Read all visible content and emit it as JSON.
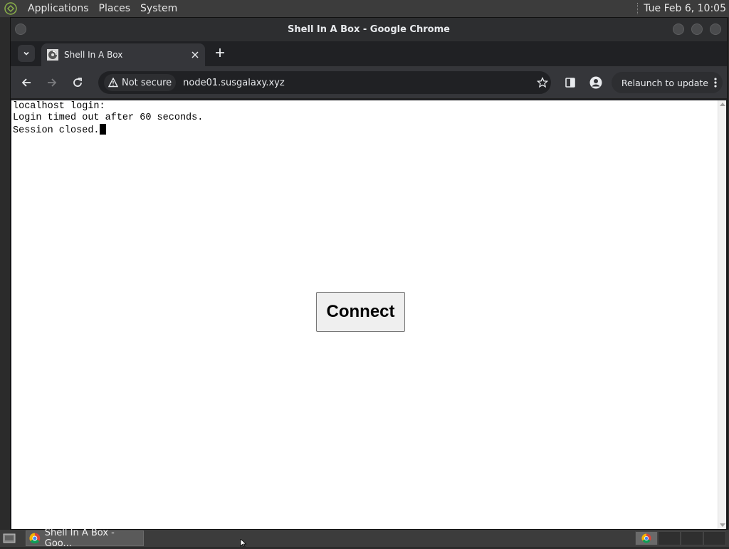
{
  "top_panel": {
    "menus": [
      "Applications",
      "Places",
      "System"
    ],
    "clock": "Tue Feb  6, 10:05"
  },
  "window": {
    "title": "Shell In A Box - Google Chrome"
  },
  "tab": {
    "title": "Shell In A Box",
    "new_tab_symbol": "+"
  },
  "toolbar": {
    "security_label": "Not secure",
    "url": "node01.susgalaxy.xyz",
    "relaunch_label": "Relaunch to update"
  },
  "terminal": {
    "lines": [
      "localhost login:",
      "Login timed out after 60 seconds.",
      "Session closed."
    ]
  },
  "connect_button": {
    "label": "Connect"
  },
  "taskbar": {
    "item_label": "Shell In A Box - Goo..."
  },
  "colors": {
    "panel_bg": "#3c3c3c",
    "chrome_frame": "#202124",
    "chrome_toolbar": "#35363a",
    "content_bg": "#ffffff"
  },
  "icons": [
    "mate-logo-icon",
    "chevron-down-icon",
    "shellinabox-favicon-icon",
    "close-icon",
    "plus-icon",
    "back-arrow-icon",
    "forward-arrow-icon",
    "reload-icon",
    "warning-icon",
    "star-icon",
    "side-panel-icon",
    "profile-icon",
    "kebab-menu-icon",
    "show-desktop-icon",
    "chrome-icon"
  ]
}
